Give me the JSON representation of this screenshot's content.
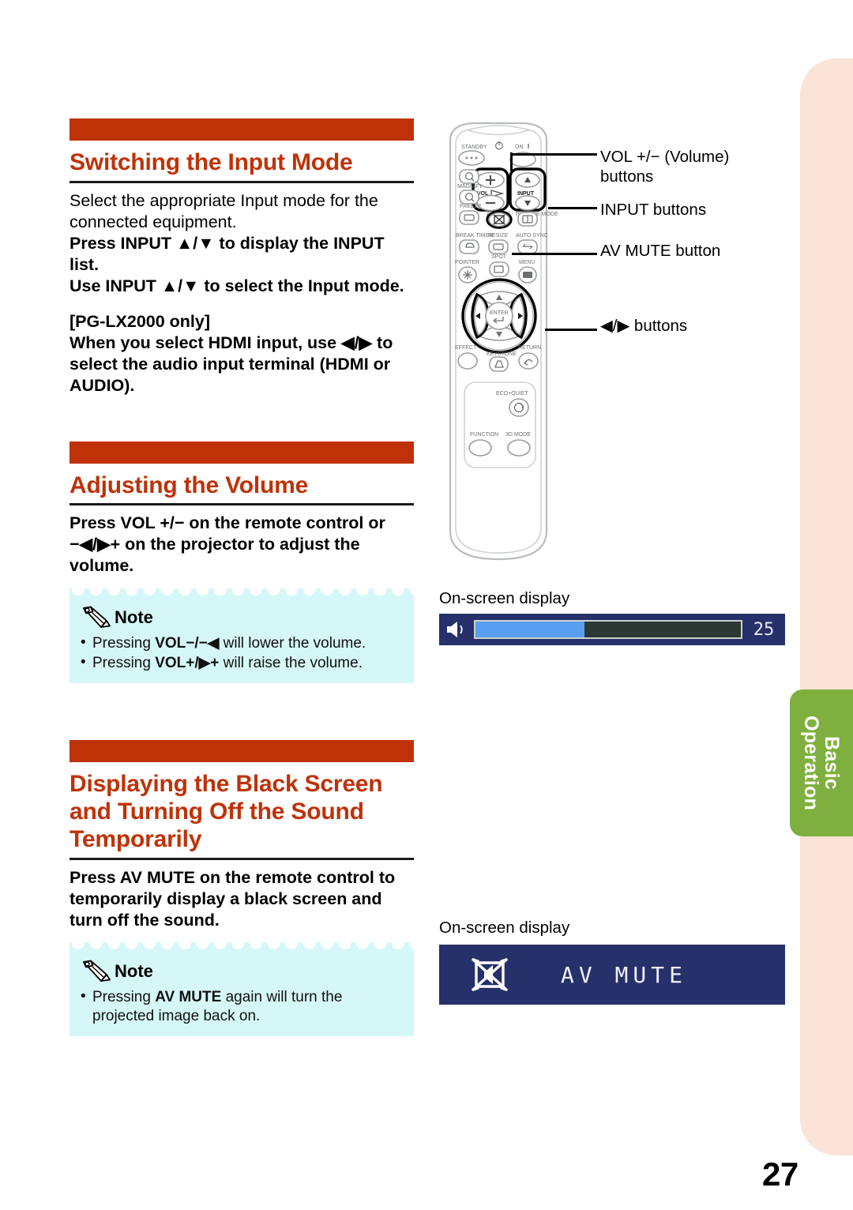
{
  "page": {
    "number": "27",
    "side_tab": "Basic\nOperation",
    "accent_orange": "#bf3208",
    "tab_green": "#7fb03f",
    "panel_peach": "#fbe3d8",
    "note_cyan": "#d6f7f7",
    "osd_navy": "#26306a",
    "osd_fill_blue": "#5a9ef0"
  },
  "sections": [
    {
      "title": "Switching the Input Mode",
      "paragraphs": [
        {
          "style": "regular",
          "text": "Select the appropriate Input mode for the connected equipment."
        },
        {
          "style": "bold",
          "text": "Press INPUT ▲/▼ to display the INPUT list."
        },
        {
          "style": "bold",
          "text": "Use INPUT ▲/▼ to select the Input mode."
        },
        {
          "style": "bold",
          "text": "[PG-LX2000 only]"
        },
        {
          "style": "bold",
          "text": "When you select HDMI input, use ◀/▶ to select the audio input terminal (HDMI or AUDIO)."
        }
      ]
    },
    {
      "title": "Adjusting the Volume",
      "paragraphs": [
        {
          "style": "bold",
          "text": "Press VOL +/− on the remote control or −◀/▶+ on the projector to adjust the volume."
        }
      ],
      "note": {
        "label": "Note",
        "items": [
          "Pressing VOL−/−◀ will lower the volume.",
          "Pressing VOL+/▶+ will raise the volume."
        ]
      }
    },
    {
      "title": "Displaying the Black Screen and Turning Off the Sound Temporarily",
      "paragraphs": [
        {
          "style": "bold",
          "text": "Press AV MUTE on the remote control to temporarily display a black screen and turn off the sound."
        }
      ],
      "note": {
        "label": "Note",
        "items": [
          "Pressing AV MUTE again will turn the projected image back on."
        ]
      }
    }
  ],
  "callouts": {
    "vol": "VOL +/− (Volume)\nbuttons",
    "input": "INPUT buttons",
    "avmute": "AV MUTE button",
    "leftright": "◀/▶ buttons"
  },
  "remote": {
    "standby": "STANDBY",
    "on": "ON",
    "magnify": "MAGNIFY",
    "freeze": "FREEZE",
    "break_timer": "BREAK TIMER",
    "pointer": "POINTER",
    "vol": "VOL",
    "input": "INPUT",
    "av_mute": "AV MUTE",
    "resize": "RESIZE",
    "picture_mode": "PICTURE MODE",
    "auto_sync": "AUTO SYNC",
    "spot": "SPOT",
    "menu": "MENU",
    "enter": "ENTER",
    "effect": "EFFECT",
    "keystone": "KEYSTONE",
    "return": "RETURN",
    "eco_quiet": "ECO+QUIET",
    "function": "FUNCTION",
    "mode_3d": "3D MODE"
  },
  "osd": {
    "volume": {
      "caption": "On-screen display",
      "value": "25",
      "fill_percent": 41
    },
    "avmute": {
      "caption": "On-screen display",
      "label": "AV MUTE"
    }
  }
}
